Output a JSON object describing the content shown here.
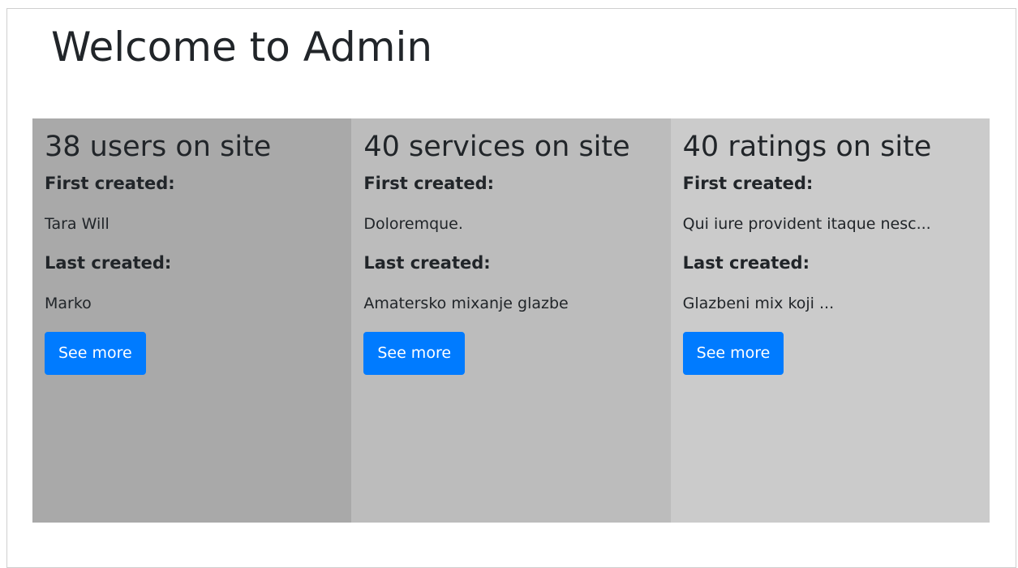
{
  "header": {
    "title": "Welcome to Admin"
  },
  "cards": [
    {
      "title": "38 users on site",
      "first_label": "First created:",
      "first_value": "Tara Will",
      "last_label": "Last created:",
      "last_value": "Marko",
      "button_label": "See more"
    },
    {
      "title": "40 services on site",
      "first_label": "First created:",
      "first_value": "Doloremque.",
      "last_label": "Last created:",
      "last_value": "Amatersko mixanje glazbe",
      "button_label": "See more"
    },
    {
      "title": "40 ratings on site",
      "first_label": "First created:",
      "first_value": "Qui iure provident itaque nesc...",
      "last_label": "Last created:",
      "last_value": "Glazbeni mix koji ...",
      "button_label": "See more"
    }
  ],
  "colors": {
    "primary_button": "#007bff",
    "users_card_bg": "#a9a9a9",
    "services_card_bg": "#bcbcbc",
    "ratings_card_bg": "#cbcbcb"
  }
}
